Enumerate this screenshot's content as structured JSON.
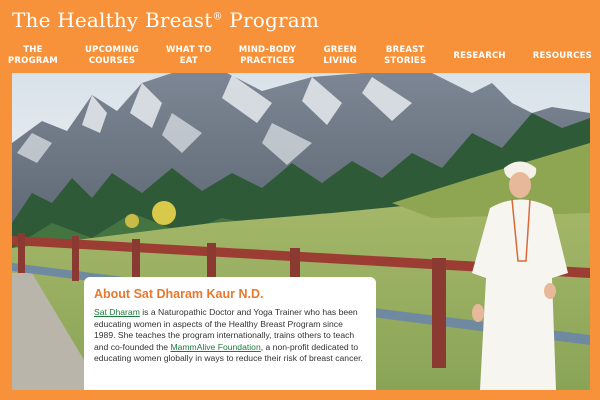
{
  "site": {
    "title": "The Healthy Breast",
    "trademark": "®",
    "title_suffix": "Program"
  },
  "nav": {
    "items": [
      {
        "line1": "The",
        "line2": "Program"
      },
      {
        "line1": "Upcoming",
        "line2": "Courses"
      },
      {
        "line1": "What to",
        "line2": "Eat"
      },
      {
        "line1": "Mind-Body",
        "line2": "Practices"
      },
      {
        "line1": "Green",
        "line2": "Living"
      },
      {
        "line1": "Breast",
        "line2": "Stories"
      },
      {
        "line1": "Research",
        "line2": ""
      },
      {
        "line1": "Resources",
        "line2": ""
      }
    ]
  },
  "about": {
    "title": "About Sat Dharam Kaur N.D.",
    "link_name": "Sat Dharam",
    "text1": " is a Naturopathic Doctor and Yoga Trainer who has been educating women in aspects of the Healthy Breast Program since 1989. She teaches the program internationally, trains others to teach and co-founded the ",
    "link_foundation": "MammAlive Foundation",
    "text2": ", a non-profit dedicated to educating women globally in ways to reduce their risk of breast cancer."
  },
  "colors": {
    "brand_orange": "#f7923a",
    "heading_orange": "#e8782e",
    "link_green": "#1a7d3a"
  }
}
